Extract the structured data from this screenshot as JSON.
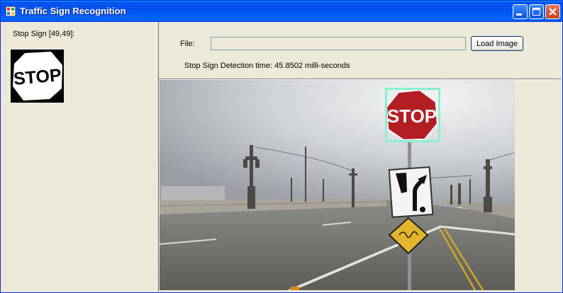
{
  "window": {
    "title": "Traffic Sign Recognition",
    "icon": "app-icon",
    "controls": [
      "minimize-icon",
      "maximize-icon",
      "close-icon"
    ]
  },
  "left_panel": {
    "detected_label": "Stop Sign [49,49]:",
    "thumbnail_text": "STOP"
  },
  "file_row": {
    "label": "File:",
    "path_value": "",
    "load_button_label": "Load Image"
  },
  "status": {
    "detection_time": "Stop Sign Detection time: 45.8502 milli-seconds"
  },
  "image": {
    "stop_sign_text": "STOP",
    "detection_box_color": "#8af0d2"
  },
  "colors": {
    "titlebar": "#0055ea",
    "window_bg": "#ece9d8",
    "close_button": "#d8522e"
  }
}
